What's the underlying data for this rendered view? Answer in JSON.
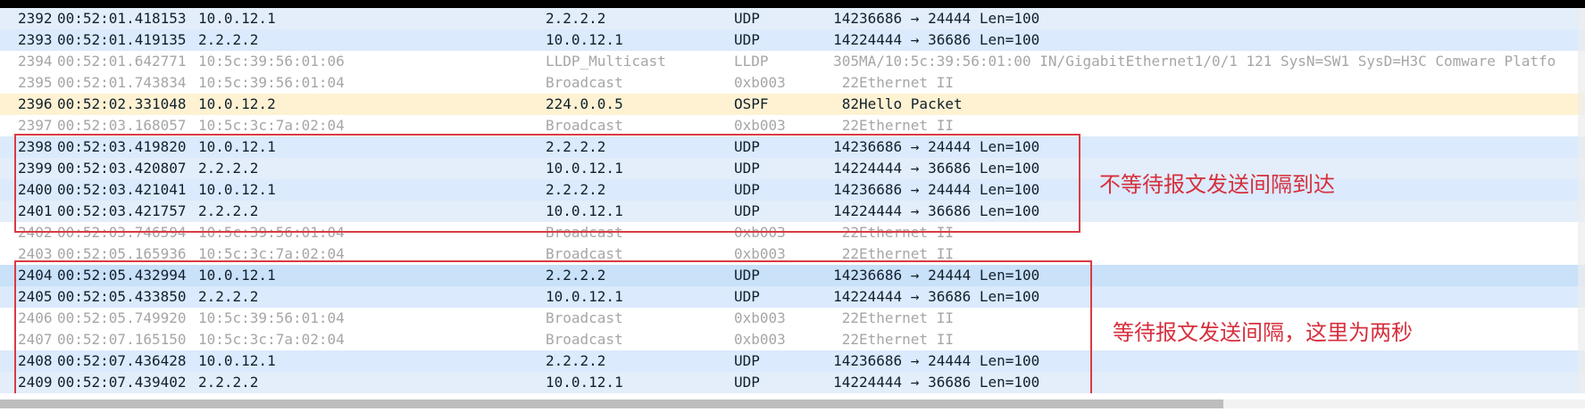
{
  "packet_list": {
    "rows": [
      {
        "no": "2392",
        "time": "00:52:01.418153",
        "source": "10.0.12.1",
        "destination": "2.2.2.2",
        "protocol": "UDP",
        "length": "142",
        "info": "36686 → 24444 Len=100",
        "type": "udp"
      },
      {
        "no": "2393",
        "time": "00:52:01.419135",
        "source": "2.2.2.2",
        "destination": "10.0.12.1",
        "protocol": "UDP",
        "length": "142",
        "info": "24444 → 36686 Len=100",
        "type": "udp"
      },
      {
        "no": "2394",
        "time": "00:52:01.642771",
        "source": "10:5c:39:56:01:06",
        "destination": "LLDP_Multicast",
        "protocol": "LLDP",
        "length": "305",
        "info": "MA/10:5c:39:56:01:00 IN/GigabitEthernet1/0/1 121 SysN=SW1 SysD=H3C Comware Platfo",
        "type": "lldp"
      },
      {
        "no": "2395",
        "time": "00:52:01.743834",
        "source": "10:5c:39:56:01:04",
        "destination": "Broadcast",
        "protocol": "0xb003",
        "length": "22",
        "info": "Ethernet II",
        "type": "eth"
      },
      {
        "no": "2396",
        "time": "00:52:02.331048",
        "source": "10.0.12.2",
        "destination": "224.0.0.5",
        "protocol": "OSPF",
        "length": "82",
        "info": "Hello Packet",
        "type": "ospf"
      },
      {
        "no": "2397",
        "time": "00:52:03.168057",
        "source": "10:5c:3c:7a:02:04",
        "destination": "Broadcast",
        "protocol": "0xb003",
        "length": "22",
        "info": "Ethernet II",
        "type": "eth"
      },
      {
        "no": "2398",
        "time": "00:52:03.419820",
        "source": "10.0.12.1",
        "destination": "2.2.2.2",
        "protocol": "UDP",
        "length": "142",
        "info": "36686 → 24444 Len=100",
        "type": "udp"
      },
      {
        "no": "2399",
        "time": "00:52:03.420807",
        "source": "2.2.2.2",
        "destination": "10.0.12.1",
        "protocol": "UDP",
        "length": "142",
        "info": "24444 → 36686 Len=100",
        "type": "udp"
      },
      {
        "no": "2400",
        "time": "00:52:03.421041",
        "source": "10.0.12.1",
        "destination": "2.2.2.2",
        "protocol": "UDP",
        "length": "142",
        "info": "36686 → 24444 Len=100",
        "type": "udp"
      },
      {
        "no": "2401",
        "time": "00:52:03.421757",
        "source": "2.2.2.2",
        "destination": "10.0.12.1",
        "protocol": "UDP",
        "length": "142",
        "info": "24444 → 36686 Len=100",
        "type": "udp"
      },
      {
        "no": "2402",
        "time": "00:52:03.746594",
        "source": "10:5c:39:56:01:04",
        "destination": "Broadcast",
        "protocol": "0xb003",
        "length": "22",
        "info": "Ethernet II",
        "type": "eth"
      },
      {
        "no": "2403",
        "time": "00:52:05.165936",
        "source": "10:5c:3c:7a:02:04",
        "destination": "Broadcast",
        "protocol": "0xb003",
        "length": "22",
        "info": "Ethernet II",
        "type": "eth"
      },
      {
        "no": "2404",
        "time": "00:52:05.432994",
        "source": "10.0.12.1",
        "destination": "2.2.2.2",
        "protocol": "UDP",
        "length": "142",
        "info": "36686 → 24444 Len=100",
        "type": "udp"
      },
      {
        "no": "2405",
        "time": "00:52:05.433850",
        "source": "2.2.2.2",
        "destination": "10.0.12.1",
        "protocol": "UDP",
        "length": "142",
        "info": "24444 → 36686 Len=100",
        "type": "udp"
      },
      {
        "no": "2406",
        "time": "00:52:05.749920",
        "source": "10:5c:39:56:01:04",
        "destination": "Broadcast",
        "protocol": "0xb003",
        "length": "22",
        "info": "Ethernet II",
        "type": "eth"
      },
      {
        "no": "2407",
        "time": "00:52:07.165150",
        "source": "10:5c:3c:7a:02:04",
        "destination": "Broadcast",
        "protocol": "0xb003",
        "length": "22",
        "info": "Ethernet II",
        "type": "eth"
      },
      {
        "no": "2408",
        "time": "00:52:07.436428",
        "source": "10.0.12.1",
        "destination": "2.2.2.2",
        "protocol": "UDP",
        "length": "142",
        "info": "36686 → 24444 Len=100",
        "type": "udp"
      },
      {
        "no": "2409",
        "time": "00:52:07.439402",
        "source": "2.2.2.2",
        "destination": "10.0.12.1",
        "protocol": "UDP",
        "length": "142",
        "info": "24444 → 36686 Len=100",
        "type": "udp"
      }
    ]
  },
  "annotations": {
    "first_note": "不等待报文发送间隔到达",
    "second_note": "等待报文发送间隔，这里为两秒"
  },
  "colors": {
    "udp": "#dbeafc",
    "ospf": "#fef2d3",
    "muted_text": "#a6a6a6",
    "annotation": "#d93b45"
  }
}
